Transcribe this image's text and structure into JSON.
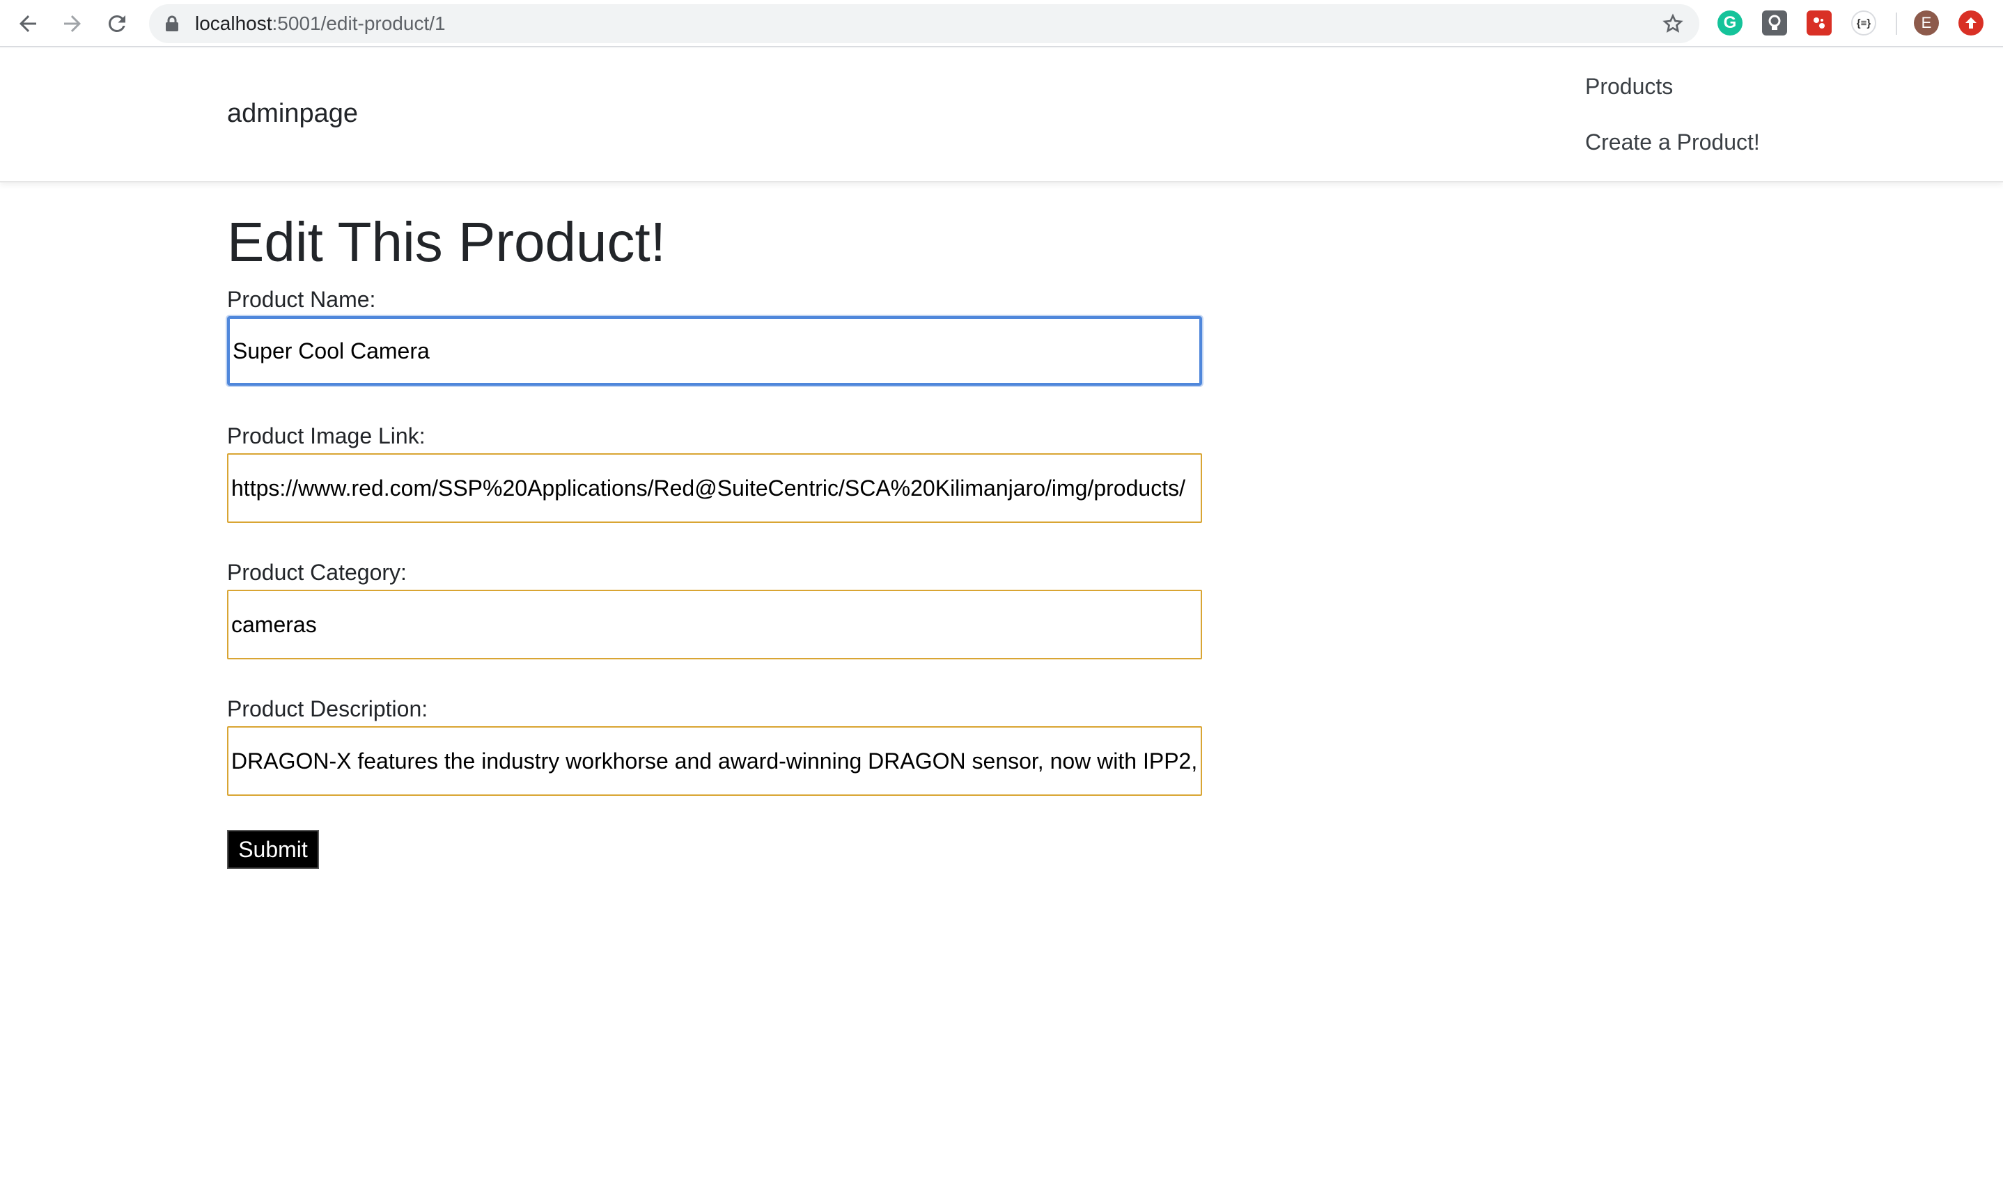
{
  "browser": {
    "url_host": "localhost",
    "url_path": ":5001/edit-product/1",
    "profile_initial": "E",
    "extensions": {
      "grammarly_letter": "G",
      "json_label": "{≡}"
    }
  },
  "header": {
    "brand": "adminpage",
    "nav": {
      "products": "Products",
      "create": "Create a Product!"
    }
  },
  "form": {
    "title": "Edit This Product!",
    "fields": {
      "name": {
        "label": "Product Name:",
        "value": "Super Cool Camera"
      },
      "image": {
        "label": "Product Image Link:",
        "value": "https://www.red.com/SSP%20Applications/Red@SuiteCentric/SCA%20Kilimanjaro/img/products/"
      },
      "category": {
        "label": "Product Category:",
        "value": "cameras"
      },
      "description": {
        "label": "Product Description:",
        "value": "DRAGON-X features the industry workhorse and award-winning DRAGON sensor, now with IPP2,"
      }
    },
    "submit_label": "Submit"
  },
  "colors": {
    "focus_border": "#4f87db",
    "input_border": "#d9a533",
    "submit_bg": "#000000"
  }
}
